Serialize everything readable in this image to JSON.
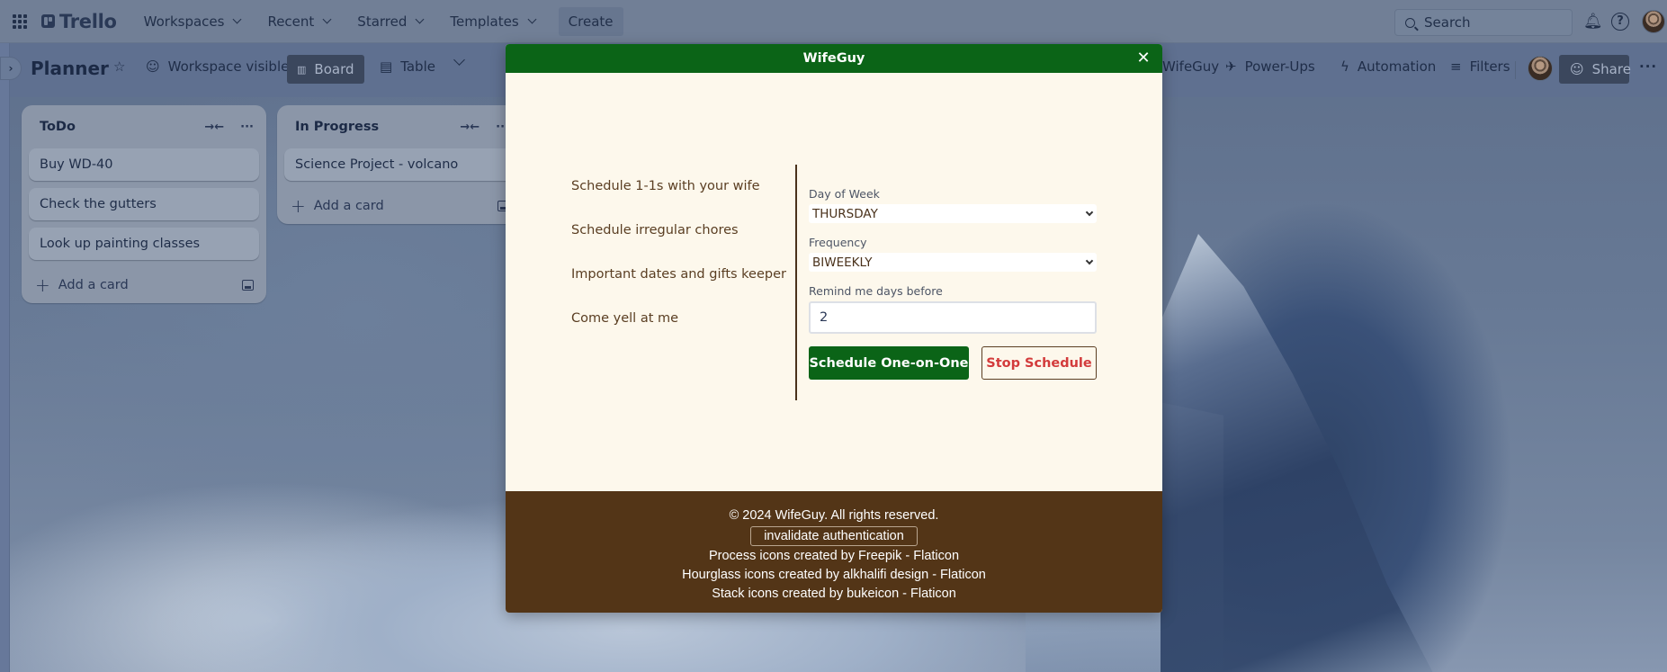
{
  "topbar": {
    "app_name": "Trello",
    "nav": [
      {
        "label": "Workspaces"
      },
      {
        "label": "Recent"
      },
      {
        "label": "Starred"
      },
      {
        "label": "Templates"
      }
    ],
    "create_label": "Create",
    "search_placeholder": "Search",
    "icons": {
      "apps": "grid-icon",
      "notifications": "bell-icon",
      "help": "question-circle-icon",
      "account": "avatar"
    }
  },
  "board": {
    "title": "Planner",
    "visibility_label": "Workspace visible",
    "views": [
      {
        "label": "Board",
        "active": true
      },
      {
        "label": "Table",
        "active": false
      }
    ],
    "right_items": [
      {
        "label": "WifeGuy"
      },
      {
        "label": "Power-Ups"
      },
      {
        "label": "Automation"
      },
      {
        "label": "Filters"
      }
    ],
    "share_label": "Share"
  },
  "lists": [
    {
      "title": "ToDo",
      "cards": [
        "Buy WD-40",
        "Check the gutters",
        "Look up painting classes"
      ],
      "add_label": "Add a card"
    },
    {
      "title": "In Progress",
      "cards": [
        "Science Project - volcano"
      ],
      "add_label": "Add a card"
    }
  ],
  "modal": {
    "title": "WifeGuy",
    "menu": [
      "Schedule 1-1s with your wife",
      "Schedule irregular chores",
      "Important dates and gifts keeper",
      "Come yell at me"
    ],
    "form": {
      "day_label": "Day of Week",
      "day_value": "THURSDAY",
      "frequency_label": "Frequency",
      "frequency_value": "BIWEEKLY",
      "remind_label": "Remind me days before",
      "remind_value": "2",
      "primary_button": "Schedule One-on-One",
      "secondary_button": "Stop Schedule"
    },
    "footer": {
      "copyright": "© 2024 WifeGuy. All rights reserved.",
      "invalidate_button": "invalidate authentication",
      "credits": [
        "Process icons created by Freepik - Flaticon",
        "Hourglass icons created by alkhalifi design - Flaticon",
        "Stack icons created by bukeicon - Flaticon"
      ]
    },
    "colors": {
      "header": "#0b6417",
      "body": "#fdf8ec",
      "footer": "#533517",
      "danger": "#d33b3b"
    }
  }
}
